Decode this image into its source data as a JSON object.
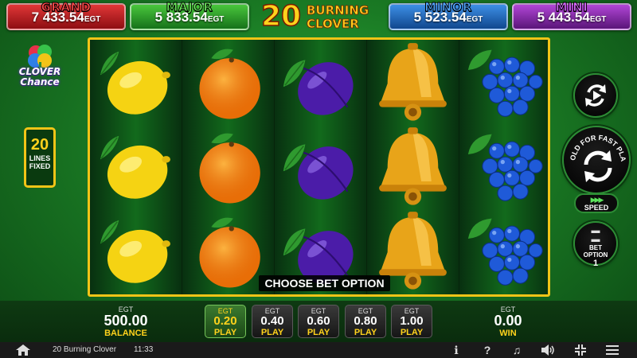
{
  "jackpots": {
    "grand": {
      "title": "GRAND",
      "value": "7 433.54",
      "currency": "EGT"
    },
    "major": {
      "title": "MAJOR",
      "value": "5 833.54",
      "currency": "EGT"
    },
    "minor": {
      "title": "MINOR",
      "value": "5 523.54",
      "currency": "EGT"
    },
    "mini": {
      "title": "MINI",
      "value": "5 443.54",
      "currency": "EGT"
    }
  },
  "game_title": {
    "number": "20",
    "line1": "BURNING",
    "line2": "CLOVER"
  },
  "logo": {
    "line1": "CLOVER",
    "line2": "Chance"
  },
  "lines": {
    "count": "20",
    "label1": "LINES",
    "label2": "FIXED"
  },
  "reels": {
    "symbols": [
      [
        "lemon",
        "lemon",
        "lemon"
      ],
      [
        "orange",
        "orange",
        "orange"
      ],
      [
        "plum",
        "plum",
        "plum"
      ],
      [
        "bell",
        "bell",
        "bell"
      ],
      [
        "grapes",
        "grapes",
        "grapes"
      ]
    ],
    "message": "CHOOSE BET OPTION"
  },
  "controls": {
    "spin_label": "HOLD FOR FAST PLAY",
    "speed_label": "SPEED",
    "bet_option_label1": "BET",
    "bet_option_label2": "OPTION",
    "bet_option_value": "1"
  },
  "bottom": {
    "balance": {
      "currency": "EGT",
      "value": "500.00",
      "label": "BALANCE"
    },
    "win": {
      "currency": "EGT",
      "value": "0.00",
      "label": "WIN"
    },
    "bets": [
      {
        "currency": "EGT",
        "value": "0.20",
        "label": "PLAY",
        "active": true
      },
      {
        "currency": "EGT",
        "value": "0.40",
        "label": "PLAY",
        "active": false
      },
      {
        "currency": "EGT",
        "value": "0.60",
        "label": "PLAY",
        "active": false
      },
      {
        "currency": "EGT",
        "value": "0.80",
        "label": "PLAY",
        "active": false
      },
      {
        "currency": "EGT",
        "value": "1.00",
        "label": "PLAY",
        "active": false
      }
    ]
  },
  "footer": {
    "game_name": "20 Burning Clover",
    "time": "11:33",
    "icons": [
      "home-icon",
      "info-icon",
      "help-icon",
      "music-icon",
      "sound-icon",
      "fullscreen-icon",
      "menu-icon"
    ]
  },
  "colors": {
    "frame": "#f2c417",
    "grand": "#e03737",
    "major": "#49c63c",
    "minor": "#3d8fe6",
    "mini": "#b146d6",
    "accent": "#ffd21c"
  }
}
